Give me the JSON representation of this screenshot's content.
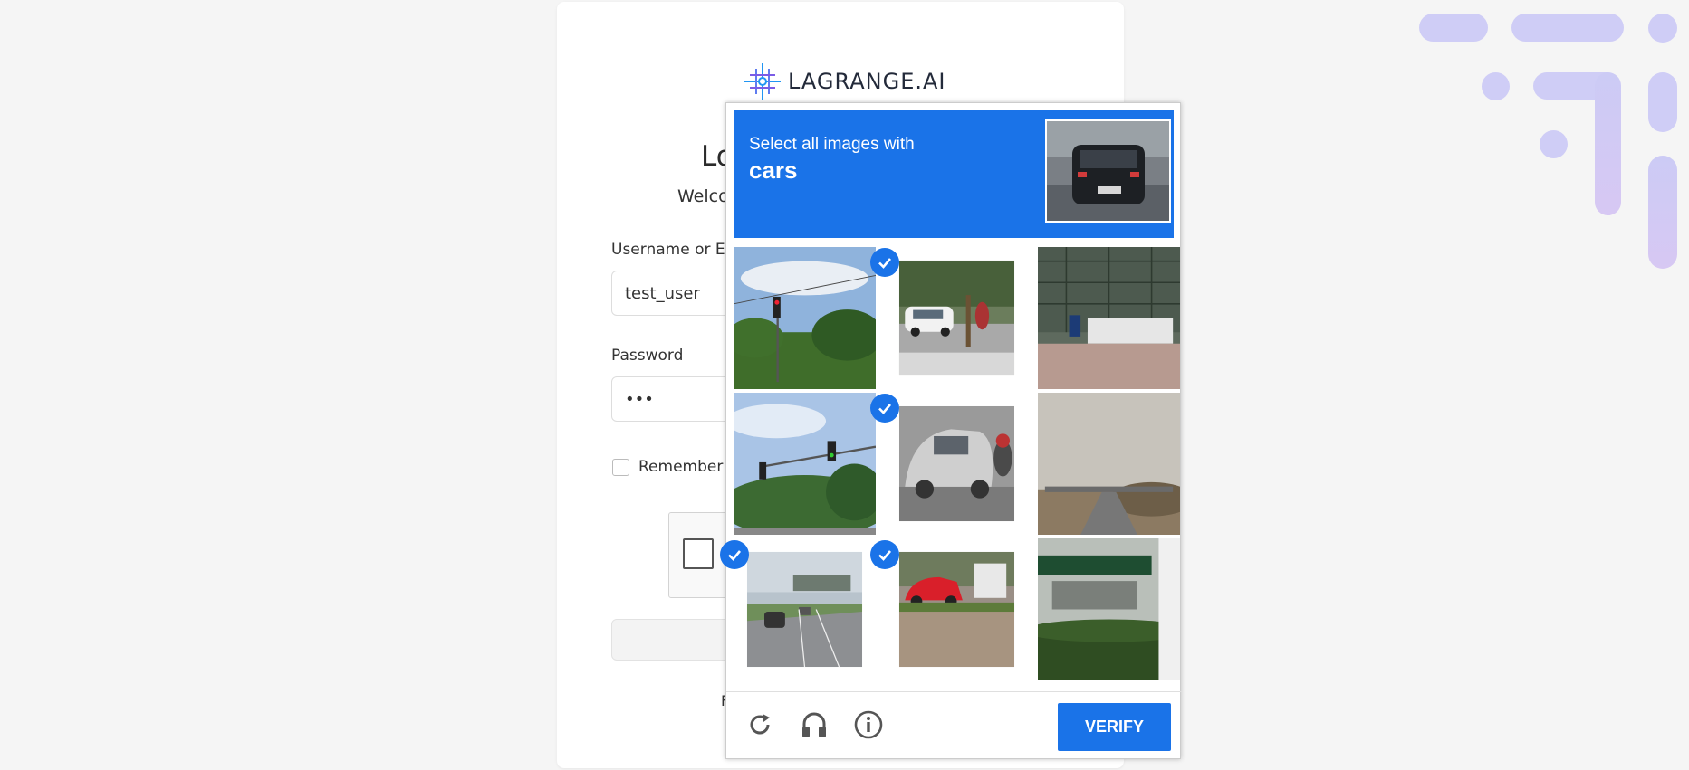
{
  "login": {
    "brand": "LAGRANGE.AI",
    "title_visible": "Lo",
    "subtitle_visible": "Welco",
    "username_label_visible": "Username or Em",
    "username_value": "test_user",
    "password_label": "Password",
    "password_value": "•••",
    "remember_label_visible": "Remember m",
    "footer_visible": "F"
  },
  "captcha": {
    "prompt_line1": "Select all images with",
    "prompt_target": "cars",
    "verify_label": "VERIFY",
    "tiles": [
      {
        "content": "traffic light, trees, sky",
        "selected": false
      },
      {
        "content": "white car, cyclist",
        "selected": true
      },
      {
        "content": "construction scaffolding",
        "selected": false
      },
      {
        "content": "traffic lights, trees",
        "selected": false
      },
      {
        "content": "silver car, motorcyclist",
        "selected": true
      },
      {
        "content": "highway overpass",
        "selected": false
      },
      {
        "content": "highway with cars",
        "selected": true
      },
      {
        "content": "red car parked",
        "selected": true
      },
      {
        "content": "building with hedge sign",
        "selected": false
      }
    ],
    "header_color": "#1a73e8",
    "icons": [
      "reload-icon",
      "audio-icon",
      "info-icon"
    ]
  }
}
